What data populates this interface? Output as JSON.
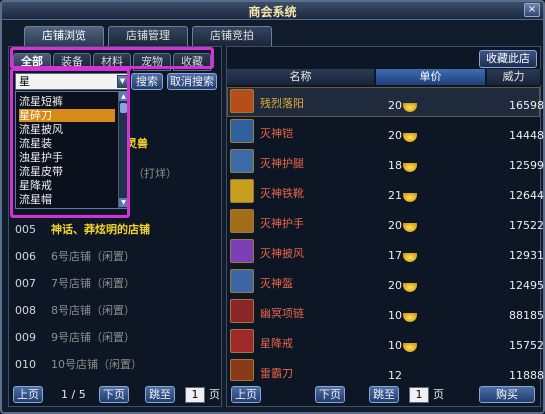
{
  "window": {
    "title": "商会系统",
    "close_label": "×"
  },
  "top_tabs": [
    {
      "label": "店铺浏览",
      "active": true
    },
    {
      "label": "店铺管理",
      "active": false
    },
    {
      "label": "店铺竞拍",
      "active": false
    }
  ],
  "category_tabs": [
    {
      "label": "全部",
      "active": true
    },
    {
      "label": "装备",
      "active": false
    },
    {
      "label": "材料",
      "active": false
    },
    {
      "label": "宠物",
      "active": false
    },
    {
      "label": "收藏",
      "active": false
    }
  ],
  "search": {
    "value": "星",
    "search_label": "搜索",
    "cancel_label": "取消搜索"
  },
  "dropdown": {
    "options": [
      "流星短裤",
      "星碎刀",
      "流星披风",
      "流星装",
      "浊星护手",
      "流星皮带",
      "星降戒",
      "流星帽"
    ],
    "selected_index": 1
  },
  "shop_partials": {
    "row2_suffix": "灵兽",
    "row4_suffix": "（打烊）"
  },
  "shops": [
    {
      "no": "005",
      "name": "神话、莽炫明的店铺",
      "highlight": true
    },
    {
      "no": "006",
      "name": "6号店铺（闲置）",
      "highlight": false
    },
    {
      "no": "007",
      "name": "7号店铺（闲置）",
      "highlight": false
    },
    {
      "no": "008",
      "name": "8号店铺（闲置）",
      "highlight": false
    },
    {
      "no": "009",
      "name": "9号店铺（闲置）",
      "highlight": false
    },
    {
      "no": "010",
      "name": "10号店铺（闲置）",
      "highlight": false
    }
  ],
  "left_pager": {
    "prev_label": "上页",
    "page_text": "1 / 5",
    "next_label": "下页",
    "jump_label": "跳至",
    "page_input": "1",
    "page_unit": "页"
  },
  "right_panel": {
    "favorite_label": "收藏此店",
    "columns": [
      "名称",
      "单价",
      "威力"
    ]
  },
  "items": [
    {
      "name": "残烈落阳",
      "price": "20",
      "power": "16598",
      "icon": "sword-icon",
      "color": "#b64c1a",
      "selected": true
    },
    {
      "name": "灭神铠",
      "price": "20",
      "power": "14448",
      "icon": "armor-icon",
      "color": "#2f5f9c",
      "selected": false
    },
    {
      "name": "灭神护腿",
      "price": "18",
      "power": "12599",
      "icon": "leg-guard-icon",
      "color": "#3a6aa8",
      "selected": false
    },
    {
      "name": "灭神铁靴",
      "price": "21",
      "power": "12644",
      "icon": "boots-icon",
      "color": "#c8a020",
      "selected": false
    },
    {
      "name": "灭神护手",
      "price": "20",
      "power": "17522",
      "icon": "gauntlet-icon",
      "color": "#a36c18",
      "selected": false
    },
    {
      "name": "灭神披风",
      "price": "17",
      "power": "12931",
      "icon": "cape-icon",
      "color": "#7d3fb8",
      "selected": false
    },
    {
      "name": "灭神盔",
      "price": "20",
      "power": "12495",
      "icon": "helmet-icon",
      "color": "#3c66a6",
      "selected": false
    },
    {
      "name": "幽冥项链",
      "price": "10",
      "power": "88185",
      "icon": "necklace-icon",
      "color": "#8c2626",
      "selected": false
    },
    {
      "name": "星降戒",
      "price": "10",
      "power": "15752",
      "icon": "ring-icon",
      "color": "#a02a2a",
      "selected": false
    },
    {
      "name": "雷霸刀",
      "price": "12",
      "power": "11888",
      "icon": "blade-icon",
      "color": "#8a3a18",
      "selected": false
    }
  ],
  "right_pager": {
    "prev_label": "上页",
    "next_label": "下页",
    "jump_label": "跳至",
    "page_input": "1",
    "page_unit": "页",
    "buy_label": "购买"
  },
  "colors": {
    "highlight_box": "#d531d8",
    "shop_highlight": "#f2d22a",
    "item_name": "#e9654a",
    "sorted_header": "#3f6db4"
  }
}
